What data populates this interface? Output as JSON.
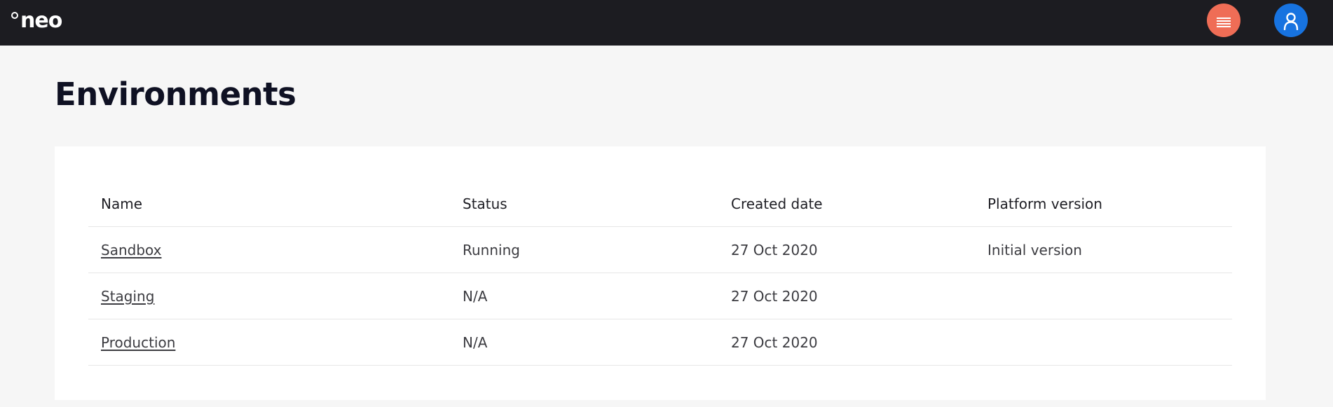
{
  "header": {
    "logo_text": "neo",
    "menu_icon": "hamburger-menu-icon",
    "user_icon": "user-icon",
    "colors": {
      "bar": "#1c1c21",
      "menu_button": "#ef6d56",
      "user_button": "#1773e0"
    }
  },
  "page": {
    "title": "Environments"
  },
  "table": {
    "columns": [
      "Name",
      "Status",
      "Created date",
      "Platform version"
    ],
    "rows": [
      {
        "name": "Sandbox",
        "status": "Running",
        "created": "27 Oct 2020",
        "platform_version": "Initial version"
      },
      {
        "name": "Staging",
        "status": "N/A",
        "created": "27 Oct 2020",
        "platform_version": ""
      },
      {
        "name": "Production",
        "status": "N/A",
        "created": "27 Oct 2020",
        "platform_version": ""
      }
    ]
  }
}
